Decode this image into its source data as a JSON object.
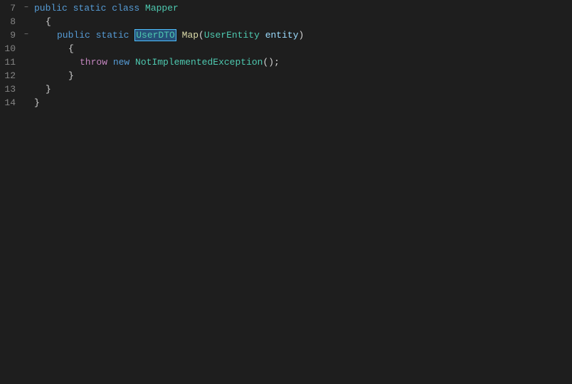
{
  "editor": {
    "background": "#1e1e1e",
    "lines": [
      {
        "number": "7",
        "foldable": true,
        "fold_symbol": "−",
        "indent": 0,
        "tokens": [
          {
            "text": "public ",
            "class": "kw-blue"
          },
          {
            "text": "static ",
            "class": "kw-blue"
          },
          {
            "text": "class ",
            "class": "kw-blue"
          },
          {
            "text": "Mapper",
            "class": "kw-type"
          }
        ]
      },
      {
        "number": "8",
        "foldable": false,
        "indent": 1,
        "tokens": [
          {
            "text": "{",
            "class": "kw-punc"
          }
        ]
      },
      {
        "number": "9",
        "foldable": true,
        "fold_symbol": "−",
        "indent": 2,
        "tokens": [
          {
            "text": "public ",
            "class": "kw-blue"
          },
          {
            "text": "static ",
            "class": "kw-blue"
          },
          {
            "text": "UserDTO",
            "class": "kw-type",
            "highlight": true
          },
          {
            "text": " ",
            "class": ""
          },
          {
            "text": "Map",
            "class": "kw-method"
          },
          {
            "text": "(",
            "class": "kw-punc"
          },
          {
            "text": "UserEntity",
            "class": "kw-type"
          },
          {
            "text": " ",
            "class": ""
          },
          {
            "text": "entity",
            "class": "kw-param"
          },
          {
            "text": ")",
            "class": "kw-punc"
          }
        ]
      },
      {
        "number": "10",
        "foldable": false,
        "indent": 2,
        "tokens": [
          {
            "text": "{",
            "class": "kw-punc"
          }
        ]
      },
      {
        "number": "11",
        "foldable": false,
        "indent": 3,
        "tokens": [
          {
            "text": "throw",
            "class": "kw-throw"
          },
          {
            "text": " ",
            "class": ""
          },
          {
            "text": "new ",
            "class": "kw-blue"
          },
          {
            "text": "NotImplementedException",
            "class": "kw-exception"
          },
          {
            "text": "();",
            "class": "kw-punc"
          }
        ]
      },
      {
        "number": "12",
        "foldable": false,
        "indent": 2,
        "tokens": [
          {
            "text": "}",
            "class": "kw-punc"
          }
        ]
      },
      {
        "number": "13",
        "foldable": false,
        "indent": 1,
        "tokens": [
          {
            "text": "}",
            "class": "kw-punc"
          }
        ]
      },
      {
        "number": "14",
        "foldable": false,
        "indent": 0,
        "tokens": [
          {
            "text": "}",
            "class": "kw-punc"
          }
        ]
      }
    ]
  }
}
